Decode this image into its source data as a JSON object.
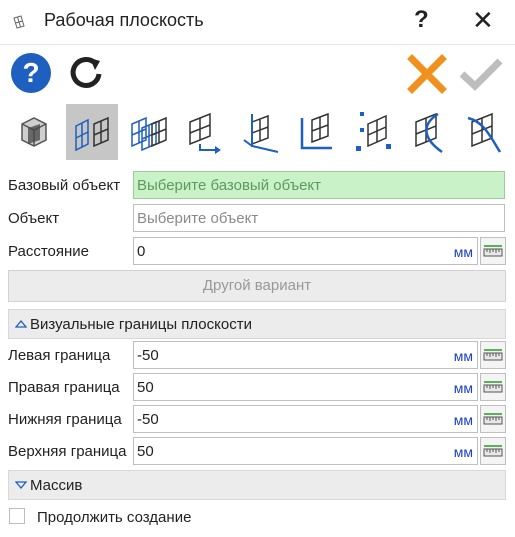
{
  "window": {
    "title": "Рабочая плоскость",
    "help_glyph": "?",
    "close_glyph": "✕"
  },
  "toolbar": {
    "help_icon": "help-circle-icon",
    "reset_icon": "refresh-icon",
    "cancel_icon": "cancel-x-icon",
    "ok_icon": "checkmark-icon",
    "accent_blue": "#1f5fbf",
    "cancel_color": "#f0901e",
    "ok_color": "#bdbdbd"
  },
  "modes": [
    {
      "name": "mode-solid-plane",
      "icon": "solid-box-plane-icon",
      "active": false
    },
    {
      "name": "mode-plane-offset",
      "icon": "plane-offset-icon",
      "active": true
    },
    {
      "name": "mode-plane-copy",
      "icon": "plane-copy-icon",
      "active": false
    },
    {
      "name": "mode-plane-arrow",
      "icon": "plane-arrow-icon",
      "active": false
    },
    {
      "name": "mode-plane-angle",
      "icon": "plane-angle-icon",
      "active": false
    },
    {
      "name": "mode-plane-edge",
      "icon": "plane-edge-icon",
      "active": false
    },
    {
      "name": "mode-plane-points",
      "icon": "plane-points-icon",
      "active": false
    },
    {
      "name": "mode-plane-curve",
      "icon": "plane-curve-icon",
      "active": false
    },
    {
      "name": "mode-plane-surface",
      "icon": "plane-surface-icon",
      "active": false
    }
  ],
  "fields": {
    "base_object": {
      "label": "Базовый объект",
      "placeholder": "Выберите базовый объект"
    },
    "object": {
      "label": "Объект",
      "placeholder": "Выберите объект"
    },
    "distance": {
      "label": "Расстояние",
      "value": "0",
      "unit": "мм"
    }
  },
  "other_variant_label": "Другой вариант",
  "visual_bounds": {
    "title": "Визуальные границы плоскости",
    "left": {
      "label": "Левая граница",
      "value": "-50",
      "unit": "мм"
    },
    "right": {
      "label": "Правая граница",
      "value": "50",
      "unit": "мм"
    },
    "bottom": {
      "label": "Нижняя граница",
      "value": "-50",
      "unit": "мм"
    },
    "top": {
      "label": "Верхняя граница",
      "value": "50",
      "unit": "мм"
    }
  },
  "array_section": {
    "title": "Массив"
  },
  "continue_creation": {
    "label": "Продолжить создание",
    "checked": false
  }
}
